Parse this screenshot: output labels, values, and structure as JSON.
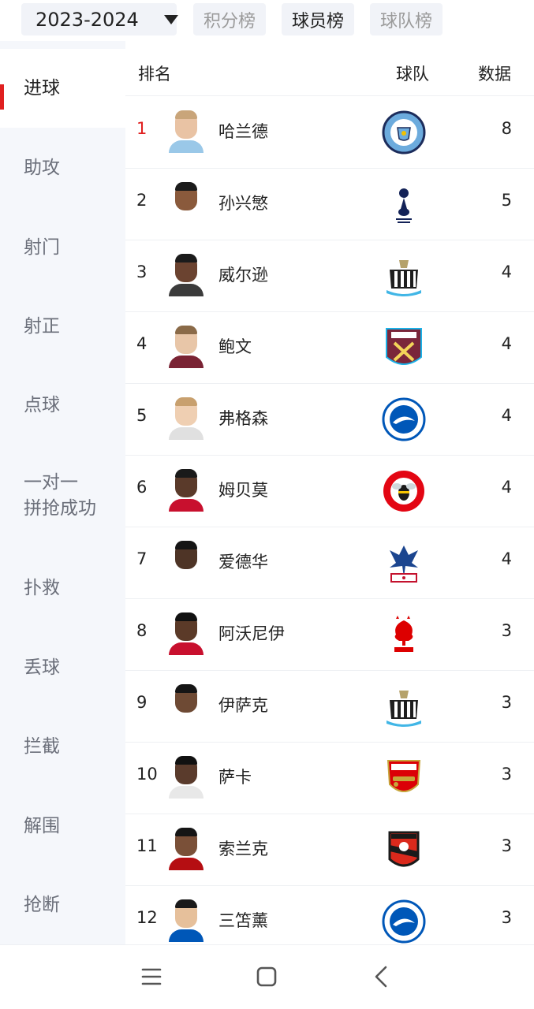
{
  "filters": {
    "season": "2023-2024",
    "tabs": [
      "积分榜",
      "球员榜",
      "球队榜"
    ],
    "active_tab": "球员榜"
  },
  "sidebar": {
    "items": [
      "进球",
      "助攻",
      "射门",
      "射正",
      "点球",
      "一对一\n拼抢成功",
      "扑救",
      "丢球",
      "拦截",
      "解围",
      "抢断"
    ],
    "active": "进球"
  },
  "table": {
    "headers": {
      "rank": "排名",
      "team": "球队",
      "data": "数据"
    },
    "rows": [
      {
        "rank": "1",
        "player": "哈兰德",
        "team_icon": "manchester-city-crest",
        "value": "8"
      },
      {
        "rank": "2",
        "player": "孙兴慜",
        "team_icon": "tottenham-crest",
        "value": "5"
      },
      {
        "rank": "3",
        "player": "威尔逊",
        "team_icon": "newcastle-crest",
        "value": "4"
      },
      {
        "rank": "4",
        "player": "鲍文",
        "team_icon": "west-ham-crest",
        "value": "4"
      },
      {
        "rank": "5",
        "player": "弗格森",
        "team_icon": "brighton-crest",
        "value": "4"
      },
      {
        "rank": "6",
        "player": "姆贝莫",
        "team_icon": "brentford-crest",
        "value": "4"
      },
      {
        "rank": "7",
        "player": "爱德华",
        "team_icon": "crystal-palace-crest",
        "value": "4"
      },
      {
        "rank": "8",
        "player": "阿沃尼伊",
        "team_icon": "nottingham-forest-crest",
        "value": "3"
      },
      {
        "rank": "9",
        "player": "伊萨克",
        "team_icon": "newcastle-crest",
        "value": "3"
      },
      {
        "rank": "10",
        "player": "萨卡",
        "team_icon": "arsenal-crest",
        "value": "3"
      },
      {
        "rank": "11",
        "player": "索兰克",
        "team_icon": "bournemouth-crest",
        "value": "3"
      },
      {
        "rank": "12",
        "player": "三笘薰",
        "team_icon": "brighton-crest",
        "value": "3"
      }
    ]
  },
  "navigation": {
    "icons": [
      "menu-icon",
      "home-square-icon",
      "back-chevron-icon"
    ]
  },
  "colors": {
    "accent": "#e02020",
    "sidebar_bg": "#f5f7fb",
    "chip_bg": "#f1f3f8"
  }
}
